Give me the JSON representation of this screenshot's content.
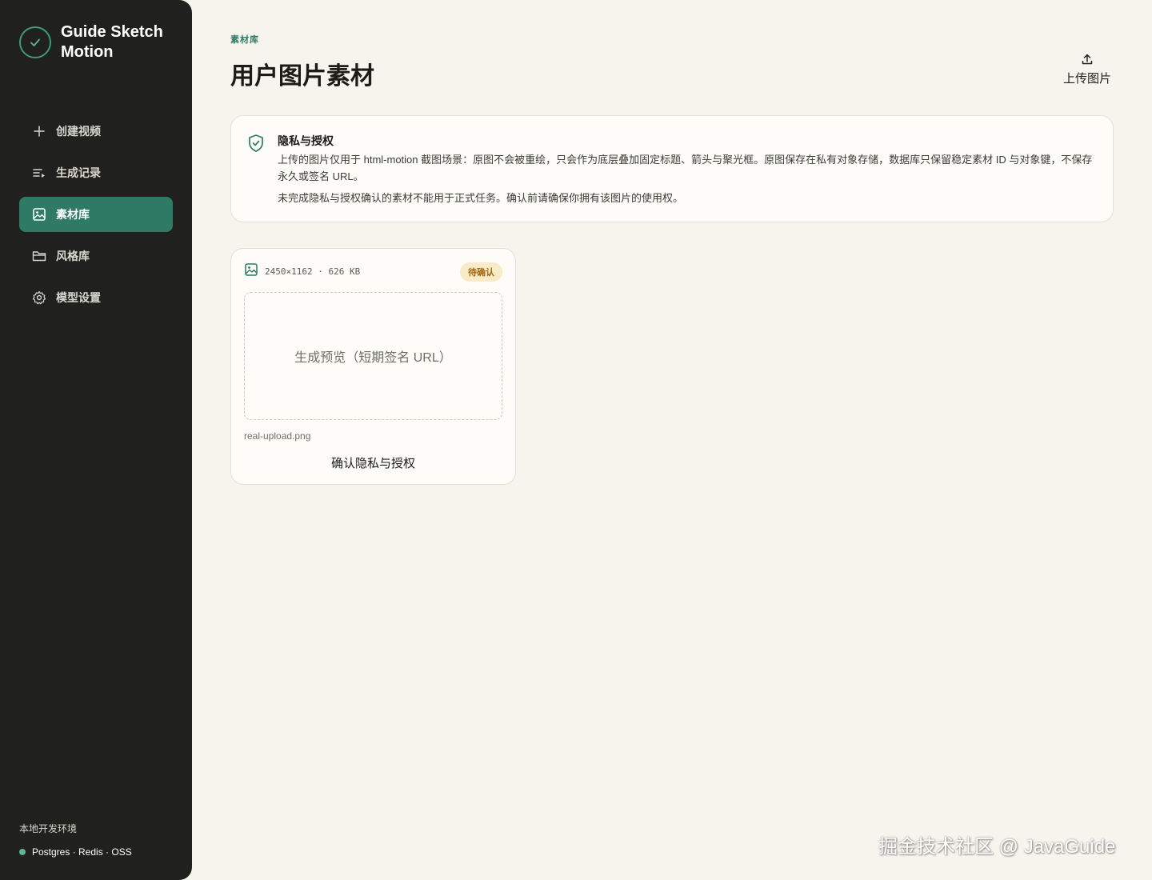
{
  "sidebar": {
    "brand": "Guide Sketch Motion",
    "items": [
      {
        "label": "创建视频",
        "icon": "plus-icon",
        "active": false
      },
      {
        "label": "生成记录",
        "icon": "list-icon",
        "active": false
      },
      {
        "label": "素材库",
        "icon": "image-icon",
        "active": true
      },
      {
        "label": "风格库",
        "icon": "folder-icon",
        "active": false
      },
      {
        "label": "模型设置",
        "icon": "gear-icon",
        "active": false
      }
    ],
    "env_title": "本地开发环境",
    "env_status": "Postgres · Redis · OSS"
  },
  "header": {
    "eyebrow": "素材库",
    "title": "用户图片素材",
    "upload_label": "上传图片"
  },
  "notice": {
    "title": "隐私与授权",
    "body": "上传的图片仅用于 html-motion 截图场景：原图不会被重绘，只会作为底层叠加固定标题、箭头与聚光框。原图保存在私有对象存储，数据库只保留稳定素材 ID 与对象键，不保存永久或签名 URL。",
    "body2": "未完成隐私与授权确认的素材不能用于正式任务。确认前请确保你拥有该图片的使用权。"
  },
  "assets": [
    {
      "meta": "2450×1162 · 626 KB",
      "badge": "待确认",
      "preview_text": "生成预览（短期签名 URL）",
      "filename": "real-upload.png",
      "action_label": "确认隐私与授权"
    }
  ],
  "watermark": "掘金技术社区 @ JavaGuide",
  "colors": {
    "sidebar_bg": "#20211e",
    "accent": "#2f7a64",
    "page_bg": "#f7f4ee",
    "badge_bg": "#f8ebc8",
    "badge_text": "#a2660f"
  }
}
